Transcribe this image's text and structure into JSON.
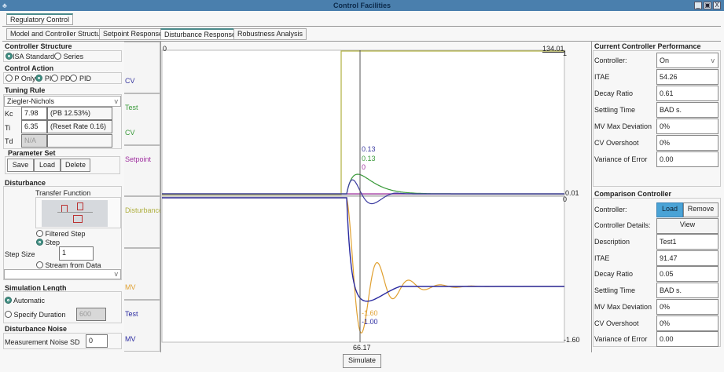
{
  "window": {
    "title": "Control Facilities",
    "buttons": [
      "_",
      "▣",
      "X"
    ]
  },
  "main_tab": "Regulatory Control",
  "tabs": [
    "Model and Controller Structure",
    "Setpoint Response",
    "Disturbance Response",
    "Robustness Analysis"
  ],
  "left": {
    "controller_structure": {
      "title": "Controller Structure",
      "options": [
        "ISA Standard",
        "Series"
      ],
      "selected": "ISA Standard"
    },
    "control_action": {
      "title": "Control Action",
      "options": [
        "P Only",
        "PI",
        "PD",
        "PID"
      ],
      "selected": "PI"
    },
    "tuning_rule": {
      "title": "Tuning Rule",
      "value": "Ziegler-Nichols",
      "rows": [
        {
          "label": "Kc",
          "value": "7.98",
          "desc": "(PB 12.53%)"
        },
        {
          "label": "Ti",
          "value": "6.35",
          "desc": "(Reset Rate 0.16)"
        },
        {
          "label": "Td",
          "value": "N/A",
          "desc": ""
        }
      ]
    },
    "parameter_set": {
      "title": "Parameter Set",
      "buttons": [
        "Save",
        "Load",
        "Delete"
      ]
    },
    "disturbance": {
      "title": "Disturbance",
      "transfer_function": "Transfer Function",
      "options": [
        "Filtered Step",
        "Step",
        "Stream from Data"
      ],
      "selected": "Step",
      "step_size_label": "Step Size",
      "step_size": "1",
      "stream_value": ""
    },
    "simulation_length": {
      "title": "Simulation Length",
      "automatic": "Automatic",
      "specify": "Specify Duration",
      "duration": "600",
      "selected": "Automatic"
    },
    "noise": {
      "title": "Disturbance Noise",
      "label": "Measurement Noise SD",
      "value": "0"
    }
  },
  "plot": {
    "legend": [
      "CV",
      "Test",
      "CV",
      "Setpoint",
      "Disturbance",
      "MV",
      "Test",
      "MV"
    ],
    "legend_colors": [
      "#3a3aa0",
      "#3a9a3a",
      "#3a9a3a",
      "#a030a0",
      "#b0b040",
      "#e0a030",
      "#2a2aa0",
      "#2a2aa0"
    ],
    "x_start": "0",
    "x_end": "134.01",
    "top_right": "1",
    "top_min": "0.01",
    "bottom_max": "0",
    "bottom_min": "-1.60",
    "cursor_x": "66.17",
    "cursor_values_top": [
      "0.13",
      "0.13",
      "0"
    ],
    "cursor_values_bottom": [
      "-1.60",
      "-1.00"
    ],
    "simulate": "Simulate"
  },
  "current": {
    "title": "Current Controller Performance",
    "rows": [
      {
        "label": "Controller:",
        "value": "On"
      },
      {
        "label": "ITAE",
        "value": "54.26"
      },
      {
        "label": "Decay Ratio",
        "value": "0.61"
      },
      {
        "label": "Settling Time",
        "value": "BAD s."
      },
      {
        "label": "MV Max Deviation",
        "value": "0%"
      },
      {
        "label": "CV Overshoot",
        "value": "0%"
      },
      {
        "label": "Variance of Error",
        "value": "0.00"
      }
    ]
  },
  "comparison": {
    "title": "Comparison Controller",
    "controller_label": "Controller:",
    "load": "Load",
    "remove": "Remove",
    "details_label": "Controller Details:",
    "view": "View",
    "rows": [
      {
        "label": "Description",
        "value": "Test1"
      },
      {
        "label": "ITAE",
        "value": "91.47"
      },
      {
        "label": "Decay Ratio",
        "value": "0.05"
      },
      {
        "label": "Settling Time",
        "value": "BAD s."
      },
      {
        "label": "MV Max Deviation",
        "value": "0%"
      },
      {
        "label": "CV Overshoot",
        "value": "0%"
      },
      {
        "label": "Variance of Error",
        "value": "0.00"
      }
    ]
  },
  "colors": {
    "titlebar": "#4a7fad",
    "accent": "#4aa3d6",
    "radio": "#3c8c80"
  }
}
